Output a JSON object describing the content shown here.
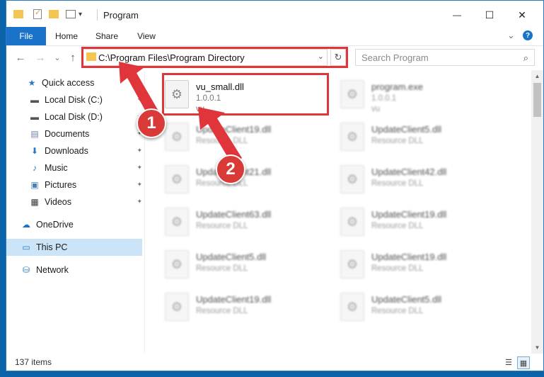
{
  "window": {
    "title": "Program"
  },
  "quick_access_toolbar": {
    "customize_glyph": "▾"
  },
  "window_controls": {
    "minimize": "—",
    "maximize": "☐",
    "close": "✕"
  },
  "ribbon": {
    "tabs": [
      "File",
      "Home",
      "Share",
      "View"
    ],
    "expand_glyph": "⌄",
    "help_glyph": "?"
  },
  "nav": {
    "back_glyph": "←",
    "forward_glyph": "→",
    "recent_glyph": "⌄",
    "up_glyph": "↑",
    "address": "C:\\Program Files\\Program Directory",
    "address_drop_glyph": "⌄",
    "refresh_glyph": "↻",
    "search_placeholder": "Search Program",
    "search_glyph": "⌕"
  },
  "sidebar": {
    "items": [
      {
        "label": "Quick access",
        "icon": "star-icon",
        "glyph": "★",
        "color": "#2b79c2"
      },
      {
        "label": "Local Disk (C:)",
        "icon": "drive-icon",
        "glyph": "▬",
        "color": "#555555",
        "pinned": true
      },
      {
        "label": "Local Disk (D:)",
        "icon": "drive-icon",
        "glyph": "▬",
        "color": "#555555",
        "pinned": true
      },
      {
        "label": "Documents",
        "icon": "documents-icon",
        "glyph": "▤",
        "color": "#6a7fa8",
        "pinned": true
      },
      {
        "label": "Downloads",
        "icon": "download-icon",
        "glyph": "⬇",
        "color": "#2b79c2",
        "pinned": true
      },
      {
        "label": "Music",
        "icon": "music-icon",
        "glyph": "♪",
        "color": "#2b79c2",
        "pinned": true
      },
      {
        "label": "Pictures",
        "icon": "pictures-icon",
        "glyph": "▣",
        "color": "#4a7fb8",
        "pinned": true
      },
      {
        "label": "Videos",
        "icon": "videos-icon",
        "glyph": "▦",
        "color": "#333333",
        "pinned": true
      },
      {
        "label": "OneDrive",
        "icon": "cloud-icon",
        "glyph": "☁",
        "color": "#1a73c9"
      },
      {
        "label": "This PC",
        "icon": "computer-icon",
        "glyph": "▭",
        "color": "#2b79c2",
        "selected": true
      },
      {
        "label": "Network",
        "icon": "network-icon",
        "glyph": "⛁",
        "color": "#2b79c2"
      }
    ],
    "pin_glyph": "📌"
  },
  "files": [
    {
      "name": "vu_small.dll",
      "version": "1.0.0.1",
      "desc": "vu",
      "highlighted": true
    },
    {
      "name": "program.exe",
      "version": "1.0.0.1",
      "desc": "vu"
    },
    {
      "name": "UpdateClient19.dll",
      "version": "",
      "desc": "Resource DLL"
    },
    {
      "name": "UpdateClient5.dll",
      "version": "",
      "desc": "Resource DLL"
    },
    {
      "name": "UpdateClient21.dll",
      "version": "",
      "desc": "Resource DLL"
    },
    {
      "name": "UpdateClient42.dll",
      "version": "",
      "desc": "Resource DLL"
    },
    {
      "name": "UpdateClient63.dll",
      "version": "",
      "desc": "Resource DLL"
    },
    {
      "name": "UpdateClient19.dll",
      "version": "",
      "desc": "Resource DLL"
    },
    {
      "name": "UpdateClient5.dll",
      "version": "",
      "desc": "Resource DLL"
    },
    {
      "name": "UpdateClient19.dll",
      "version": "",
      "desc": "Resource DLL"
    },
    {
      "name": "UpdateClient19.dll",
      "version": "",
      "desc": "Resource DLL"
    },
    {
      "name": "UpdateClient5.dll",
      "version": "",
      "desc": "Resource DLL"
    }
  ],
  "file_glyph": "⚙",
  "status": {
    "item_count": "137 items"
  },
  "callouts": [
    "1",
    "2"
  ],
  "colors": {
    "accent": "#1a73c9",
    "highlight": "#e0353a",
    "selected": "#cce4f7"
  }
}
